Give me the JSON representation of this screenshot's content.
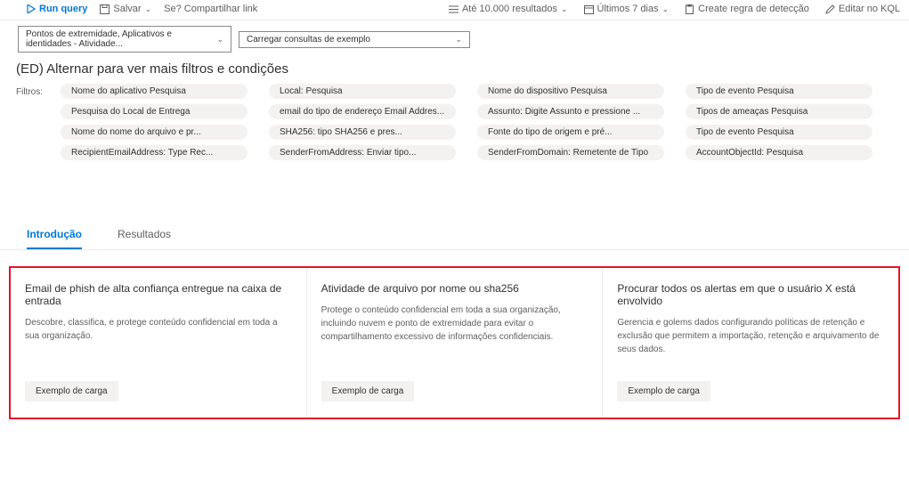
{
  "toolbar": {
    "run_query": "Run query",
    "save": "Salvar",
    "share": "Se? Compartilhar link",
    "results_limit": "Até 10.000 resultados",
    "time_range": "Últimos 7 dias",
    "create_rule": "Create regra de detecção",
    "edit_kql": "Editar no KQL"
  },
  "dropdowns": {
    "scope": "Pontos de extremidade, Aplicativos e identidades - Atividade...",
    "samples": "Carregar consultas de exemplo"
  },
  "heading": "(ED) Alternar para ver mais filtros e condições",
  "filters_label": "Filtros:",
  "filters": [
    "Nome do aplicativo Pesquisa",
    "Local: Pesquisa",
    "Nome do dispositivo Pesquisa",
    "Tipo de evento Pesquisa",
    "Pesquisa do Local de Entrega",
    "email do tipo de endereço Email Addres...",
    "Assunto: Digite Assunto e pressione ...",
    "Tipos de ameaças Pesquisa",
    "Nome do nome do arquivo e pr...",
    "SHA256: tipo SHA256 e pres...",
    "Fonte do tipo de origem e pré...",
    "Tipo de evento Pesquisa",
    "RecipientEmailAddress: Type Rec...",
    "SenderFromAddress: Enviar tipo...",
    "SenderFromDomain: Remetente de Tipo",
    "AccountObjectId: Pesquisa"
  ],
  "tabs": {
    "intro": "Introdução",
    "results": "Resultados"
  },
  "cards": [
    {
      "title": "Email de phish de alta confiança entregue na caixa de entrada",
      "desc": "Descobre, classifica, e protege conteúdo confidencial em toda a sua organização.",
      "button": "Exemplo de carga"
    },
    {
      "title": "Atividade de arquivo por nome ou sha256",
      "desc": "Protege o conteúdo confidencial em toda a sua organização, incluindo nuvem e ponto de extremidade para evitar o compartilhamento excessivo de informações confidenciais.",
      "button": "Exemplo de carga"
    },
    {
      "title": "Procurar todos os alertas em que o usuário X está envolvido",
      "desc": "Gerencia e golems dados configurando políticas de retenção e exclusão que permitem a importação, retenção e arquivamento de seus dados.",
      "button": "Exemplo de carga"
    }
  ]
}
